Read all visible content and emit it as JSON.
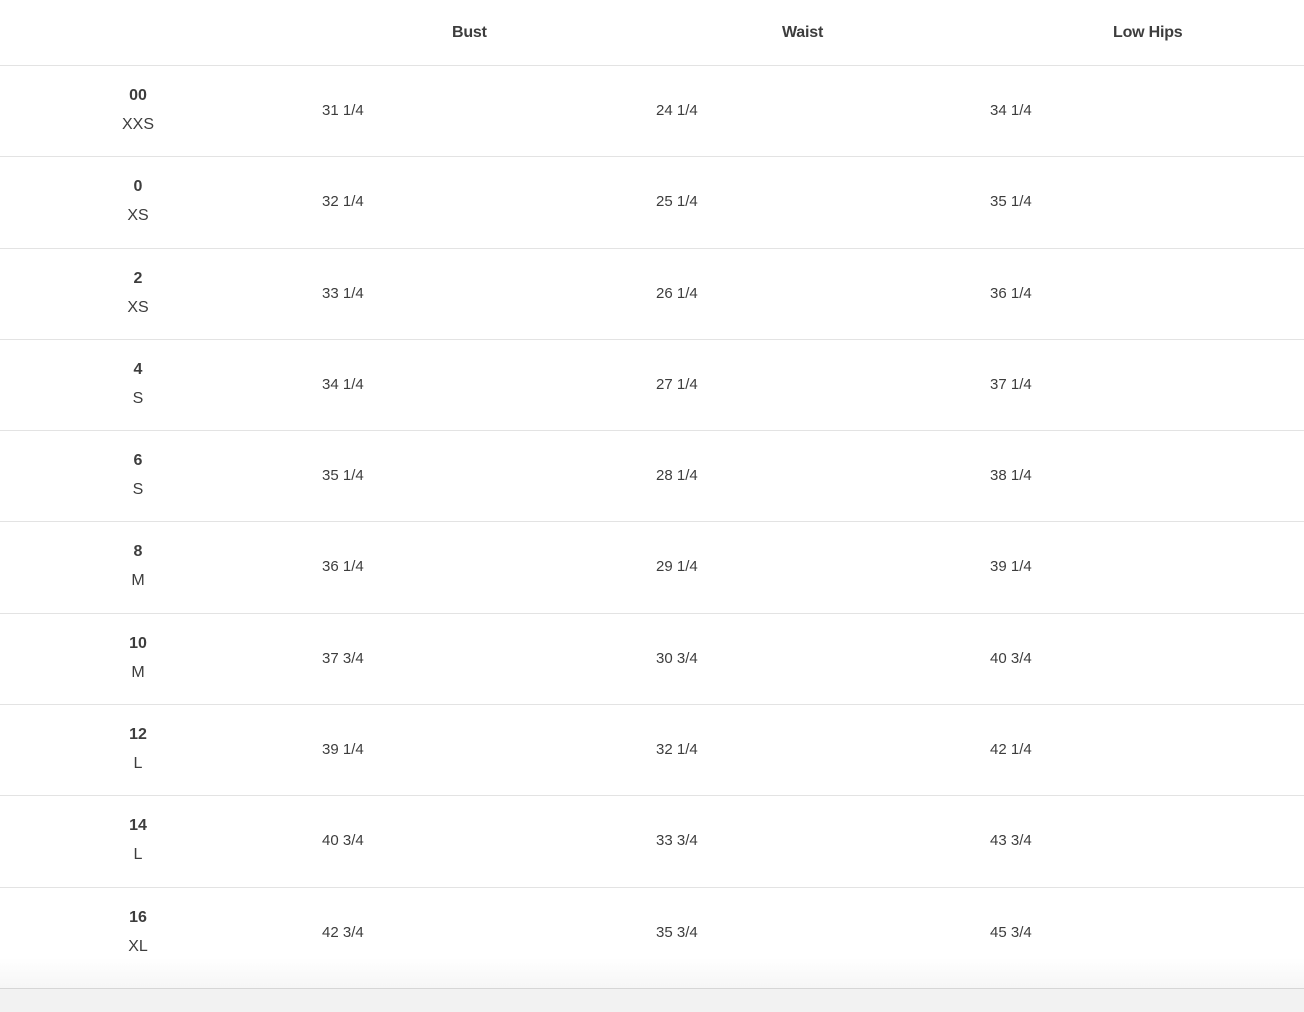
{
  "headers": {
    "bust": "Bust",
    "waist": "Waist",
    "low_hips": "Low Hips"
  },
  "rows": [
    {
      "size": "00",
      "letter": "XXS",
      "bust": "31 1/4",
      "waist": "24 1/4",
      "low_hips": "34 1/4"
    },
    {
      "size": "0",
      "letter": "XS",
      "bust": "32 1/4",
      "waist": "25 1/4",
      "low_hips": "35 1/4"
    },
    {
      "size": "2",
      "letter": "XS",
      "bust": "33 1/4",
      "waist": "26 1/4",
      "low_hips": "36 1/4"
    },
    {
      "size": "4",
      "letter": "S",
      "bust": "34 1/4",
      "waist": "27 1/4",
      "low_hips": "37 1/4"
    },
    {
      "size": "6",
      "letter": "S",
      "bust": "35 1/4",
      "waist": "28 1/4",
      "low_hips": "38 1/4"
    },
    {
      "size": "8",
      "letter": "M",
      "bust": "36 1/4",
      "waist": "29 1/4",
      "low_hips": "39 1/4"
    },
    {
      "size": "10",
      "letter": "M",
      "bust": "37 3/4",
      "waist": "30 3/4",
      "low_hips": "40 3/4"
    },
    {
      "size": "12",
      "letter": "L",
      "bust": "39 1/4",
      "waist": "32 1/4",
      "low_hips": "42 1/4"
    },
    {
      "size": "14",
      "letter": "L",
      "bust": "40 3/4",
      "waist": "33 3/4",
      "low_hips": "43 3/4"
    },
    {
      "size": "16",
      "letter": "XL",
      "bust": "42 3/4",
      "waist": "35 3/4",
      "low_hips": "45 3/4"
    }
  ]
}
